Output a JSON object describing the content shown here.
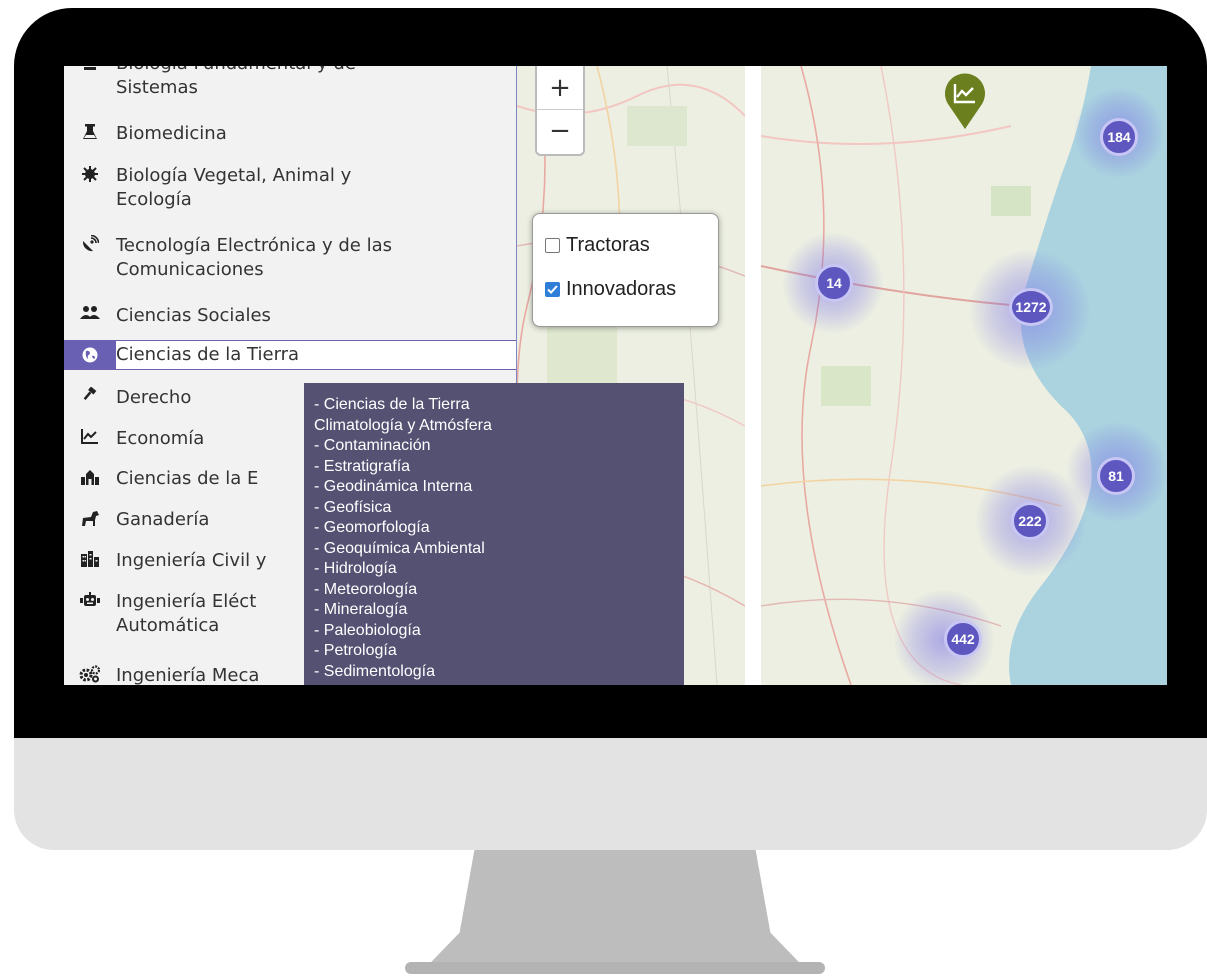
{
  "sidebar": {
    "items": [
      {
        "icon": "flask-microscope-icon",
        "label_line1": "Biología Fundamental y de",
        "label_line2": "Sistemas"
      },
      {
        "icon": "flask-icon",
        "label_line1": "Biomedicina",
        "label_line2": ""
      },
      {
        "icon": "virus-icon",
        "label_line1": "Biología Vegetal, Animal y",
        "label_line2": "Ecología"
      },
      {
        "icon": "satellite-dish-icon",
        "label_line1": "Tecnología Electrónica y de las",
        "label_line2": "Comunicaciones"
      },
      {
        "icon": "users-icon",
        "label_line1": "Ciencias Sociales",
        "label_line2": ""
      },
      {
        "icon": "globe-icon",
        "label_line1": "Ciencias de la Tierra",
        "label_line2": "",
        "active": true
      },
      {
        "icon": "gavel-icon",
        "label_line1": "Derecho",
        "label_line2": ""
      },
      {
        "icon": "chart-line-icon",
        "label_line1": "Economía",
        "label_line2": ""
      },
      {
        "icon": "school-icon",
        "label_line1": "Ciencias de la E",
        "label_line2": ""
      },
      {
        "icon": "horse-icon",
        "label_line1": "Ganadería",
        "label_line2": ""
      },
      {
        "icon": "city-icon",
        "label_line1": "Ingeniería Civil y",
        "label_line2": ""
      },
      {
        "icon": "robot-icon",
        "label_line1": "Ingeniería Eléct",
        "label_line2": "Automática"
      },
      {
        "icon": "cogs-icon",
        "label_line1": "Ingeniería Meca",
        "label_line2": ""
      }
    ]
  },
  "map_controls": {
    "zoom_in": "+",
    "zoom_out": "−"
  },
  "layers": {
    "tractoras": {
      "label": "Tractoras",
      "checked": false
    },
    "innovadoras": {
      "label": "Innovadoras",
      "checked": true
    }
  },
  "tooltip": {
    "lines": [
      "- Ciencias de la Tierra",
      "Climatología y Atmósfera",
      "- Contaminación",
      "- Estratigrafía",
      "- Geodinámica Interna",
      "- Geofísica",
      "- Geomorfología",
      "- Geoquímica Ambiental",
      "- Hidrología",
      "- Meteorología",
      "- Mineralogía",
      "- Paleobiología",
      "- Petrología",
      "- Sedimentología"
    ]
  },
  "clusters": [
    {
      "id": "cluster-184",
      "count": "184"
    },
    {
      "id": "cluster-14",
      "count": "14"
    },
    {
      "id": "cluster-1272",
      "count": "1272"
    },
    {
      "id": "cluster-81",
      "count": "81"
    },
    {
      "id": "cluster-222",
      "count": "222"
    },
    {
      "id": "cluster-442",
      "count": "442"
    }
  ],
  "colors": {
    "active_accent": "#6a60b3",
    "tooltip_bg": "#555173",
    "cluster": "#5d57bf",
    "pin": "#6b7f1e",
    "sea": "#aad3df"
  }
}
